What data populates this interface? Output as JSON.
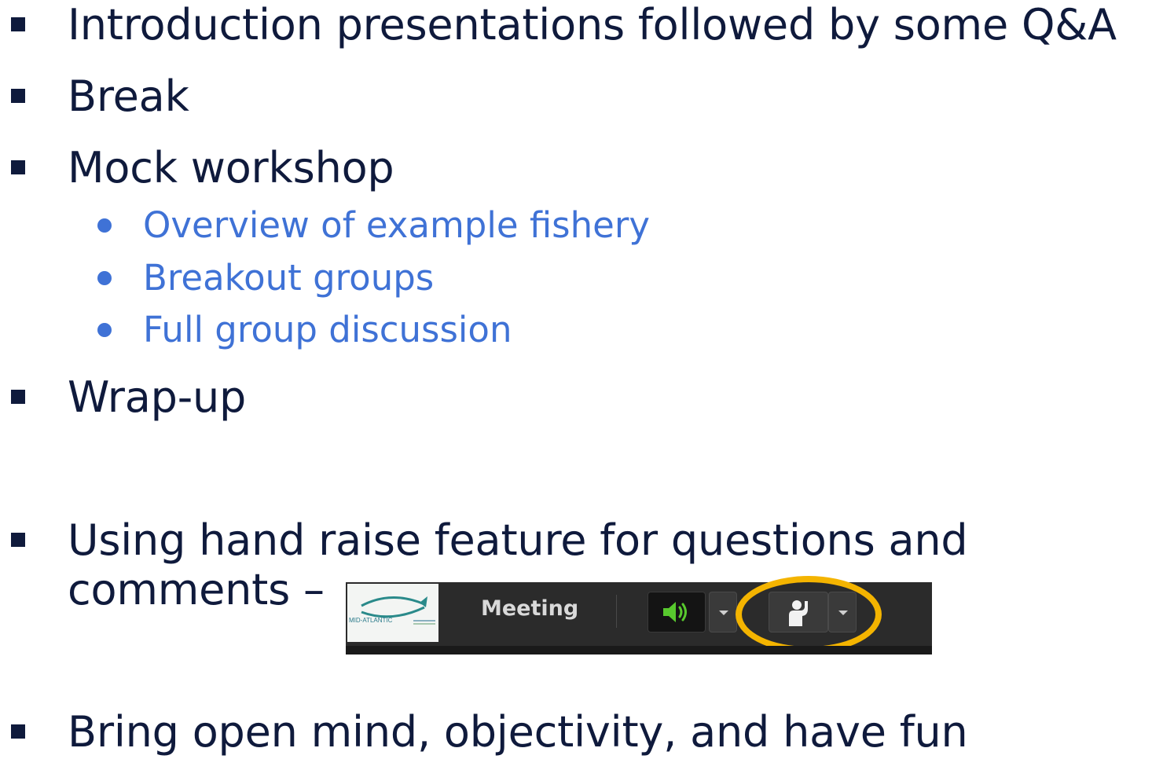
{
  "agenda": {
    "items": [
      {
        "text": "Introduction presentations followed by some Q&A"
      },
      {
        "text": "Break"
      },
      {
        "text": "Mock workshop"
      },
      {
        "text": "Overview of example fishery"
      },
      {
        "text": "Breakout groups"
      },
      {
        "text": "Full group discussion"
      },
      {
        "text": "Wrap-up"
      },
      {
        "text": "Using hand raise feature for questions and"
      },
      {
        "text": "comments –"
      },
      {
        "text": "Bring open mind, objectivity, and have fun"
      }
    ]
  },
  "toolbar": {
    "logo_text": "MID-ATLANTIC",
    "meeting_label": "Meeting",
    "speaker_icon": "speaker-volume-icon",
    "hand_icon": "raise-hand-icon",
    "dropdown_icon": "chevron-down-icon",
    "highlight_color": "#f4b400"
  },
  "colors": {
    "primary_text": "#0f1a3c",
    "sub_bullet": "#3f72d6"
  }
}
